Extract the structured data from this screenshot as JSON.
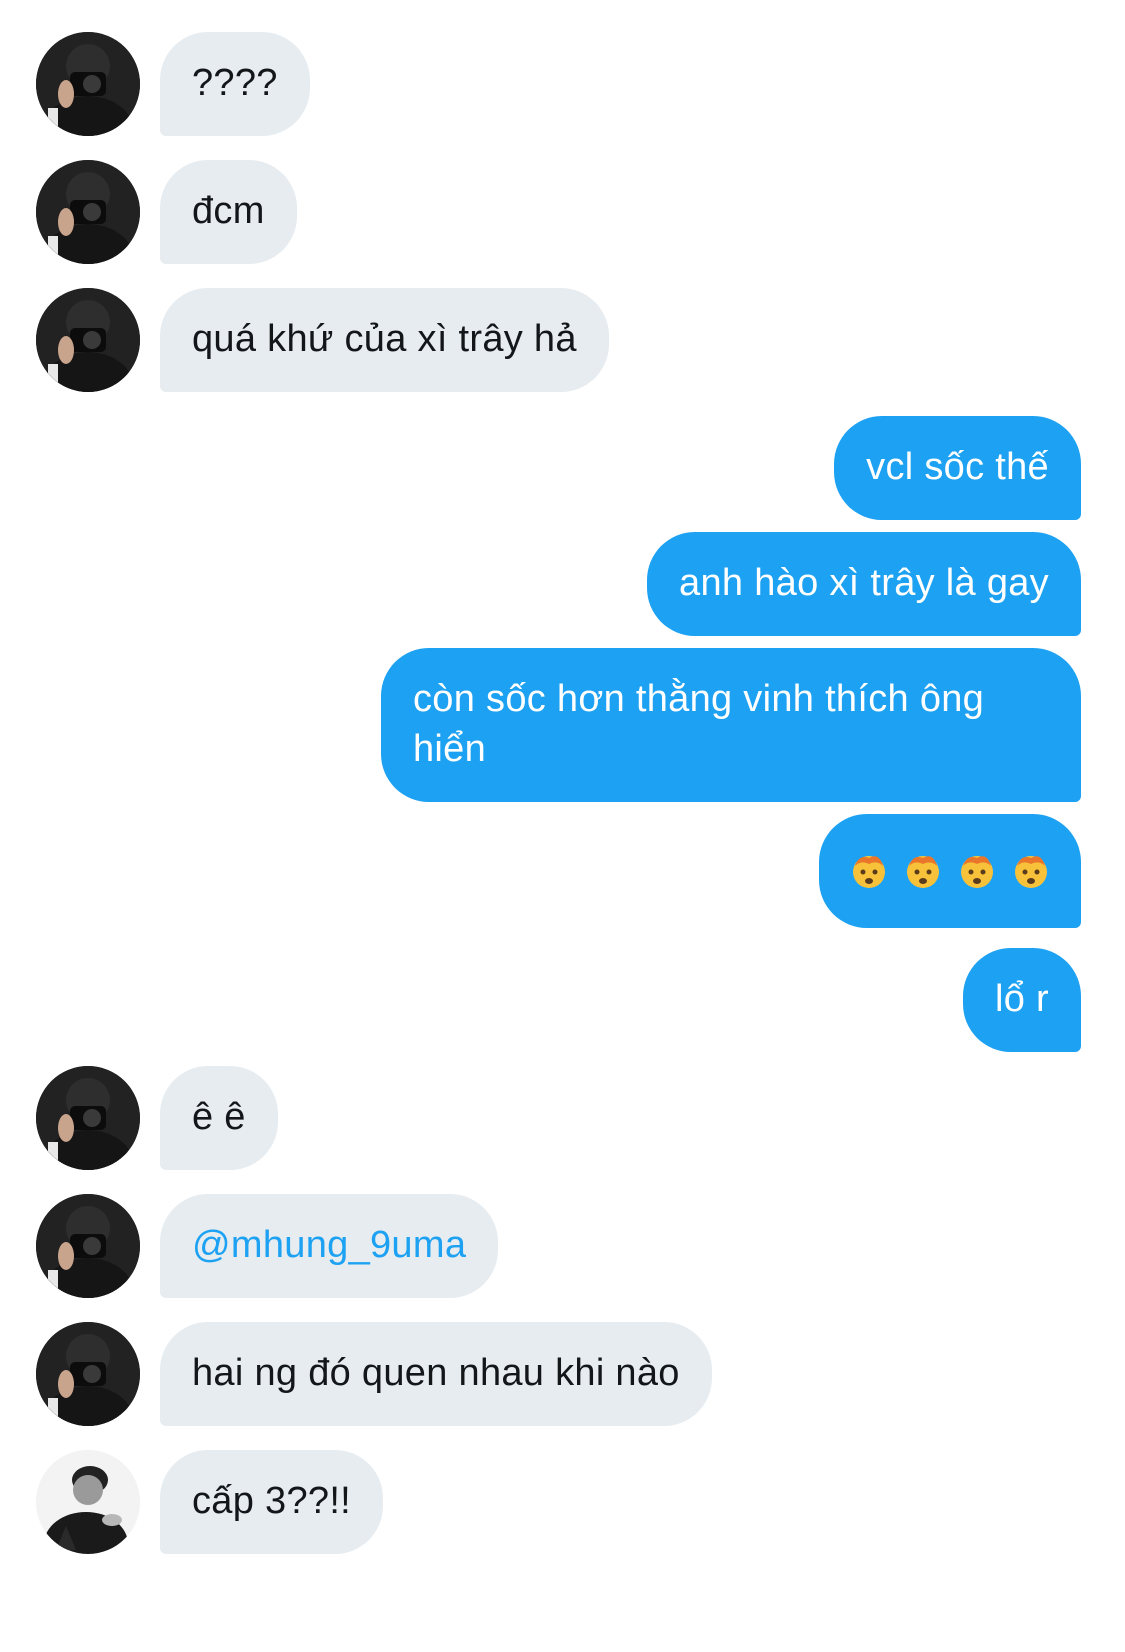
{
  "conversation": {
    "messages": [
      {
        "side": "in",
        "text": "????"
      },
      {
        "side": "in",
        "text": "đcm"
      },
      {
        "side": "in",
        "text": "quá khứ của xì trây hả"
      },
      {
        "side": "out",
        "text": "vcl sốc thế"
      },
      {
        "side": "out",
        "text": "anh hào xì trây là gay"
      },
      {
        "side": "out",
        "text": "còn sốc hơn thằng vinh thích ông hiển"
      },
      {
        "side": "out",
        "emoji": [
          "mind-blown-icon",
          "mind-blown-icon",
          "mind-blown-icon",
          "mind-blown-icon"
        ]
      },
      {
        "side": "out",
        "text": "lổ r"
      },
      {
        "side": "in",
        "text": "ê ê"
      },
      {
        "side": "in",
        "text": "@mhung_9uma"
      },
      {
        "side": "in",
        "text": "hai ng đó quen nhau khi nào"
      },
      {
        "side": "in",
        "text": "cấp 3??!!"
      }
    ]
  },
  "colors": {
    "incoming_bubble": "#e6ecf0",
    "outgoing_bubble": "#1da1f2",
    "incoming_text": "#14171a",
    "outgoing_text": "#ffffff",
    "mention": "#1da1f2"
  }
}
